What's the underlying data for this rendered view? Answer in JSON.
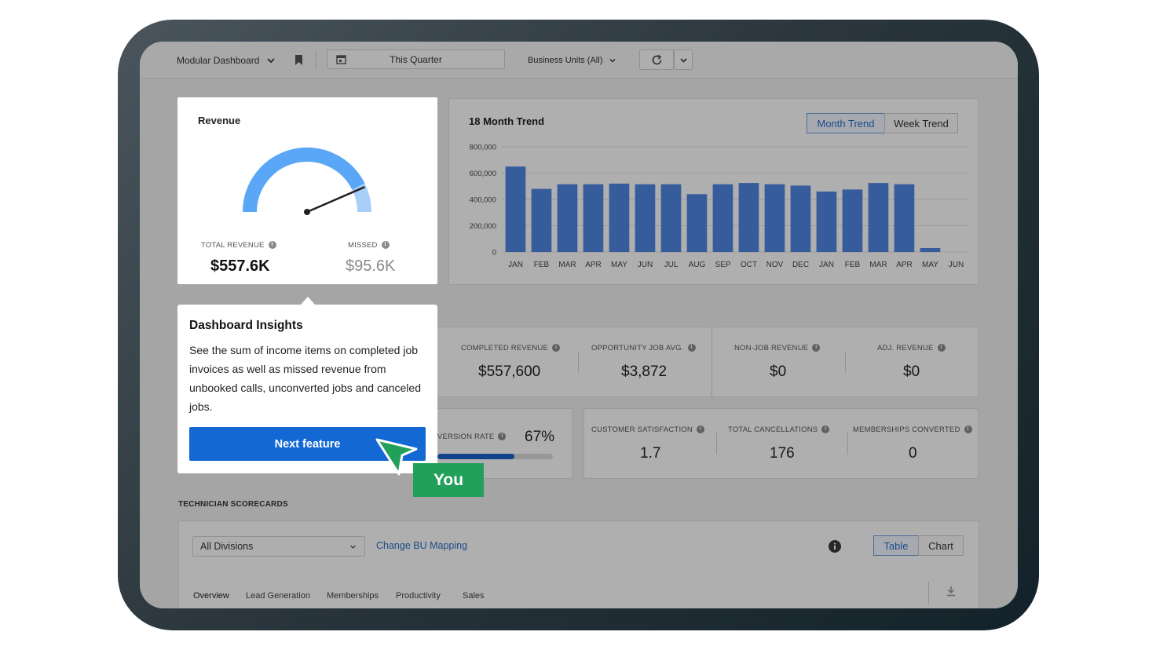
{
  "topbar": {
    "dashboard_name": "Modular Dashboard",
    "date_range": "This Quarter",
    "business_units": "Business Units (All)"
  },
  "revenue_card": {
    "title": "Revenue",
    "total_label": "TOTAL REVENUE",
    "total_value": "$557.6K",
    "missed_label": "MISSED",
    "missed_value": "$95.6K",
    "gauge_fraction": 0.853
  },
  "trend_card": {
    "title": "18 Month Trend",
    "toggle": [
      "Month Trend",
      "Week Trend"
    ],
    "active_toggle": "Month Trend"
  },
  "chart_data": {
    "type": "bar",
    "title": "18 Month Trend",
    "categories": [
      "JAN",
      "FEB",
      "MAR",
      "APR",
      "MAY",
      "JUN",
      "JUL",
      "AUG",
      "SEP",
      "OCT",
      "NOV",
      "DEC",
      "JAN",
      "FEB",
      "MAR",
      "APR",
      "MAY",
      "JUN"
    ],
    "values": [
      650000,
      480000,
      515000,
      515000,
      520000,
      515000,
      515000,
      440000,
      515000,
      525000,
      515000,
      505000,
      460000,
      475000,
      525000,
      515000,
      30000,
      0
    ],
    "ylim": [
      0,
      800000
    ],
    "yticks": [
      "800,000",
      "600,000",
      "400,000",
      "200,000",
      "0"
    ],
    "color": "#4f84e0",
    "grid": true,
    "legend": "none"
  },
  "metrics_row1": [
    {
      "label": "COMPLETED REVENUE",
      "value": "$557,600"
    },
    {
      "label": "OPPORTUNITY JOB AVG.",
      "value": "$3,872"
    },
    {
      "label": "NON-JOB REVENUE",
      "value": "$0"
    },
    {
      "label": "ADJ. REVENUE",
      "value": "$0"
    }
  ],
  "conversion": {
    "label": "VERSION RATE",
    "value": "67%",
    "fraction": 0.67
  },
  "metrics_row2": [
    {
      "label": "CUSTOMER SATISFACTION",
      "value": "1.7"
    },
    {
      "label": "TOTAL CANCELLATIONS",
      "value": "176"
    },
    {
      "label": "MEMBERSHIPS CONVERTED",
      "value": "0"
    }
  ],
  "tooltip": {
    "title": "Dashboard Insights",
    "body": "See the sum of income items on completed job invoices as well as missed revenue from unbooked calls, unconverted jobs and canceled jobs.",
    "button": "Next feature"
  },
  "cursor_label": "You",
  "scorecards": {
    "section_title": "TECHNICIAN SCORECARDS",
    "division_select": "All Divisions",
    "mapping_link": "Change BU Mapping",
    "view_toggle": [
      "Table",
      "Chart"
    ],
    "active_view": "Table",
    "tabs": [
      "Overview",
      "Lead Generation",
      "Memberships",
      "Productivity",
      "Sales"
    ]
  },
  "colors": {
    "primary_blue": "#1368d4",
    "gauge_blue": "#5aa6f7",
    "gauge_light": "#a8cff9",
    "you_green": "#22a05a"
  }
}
